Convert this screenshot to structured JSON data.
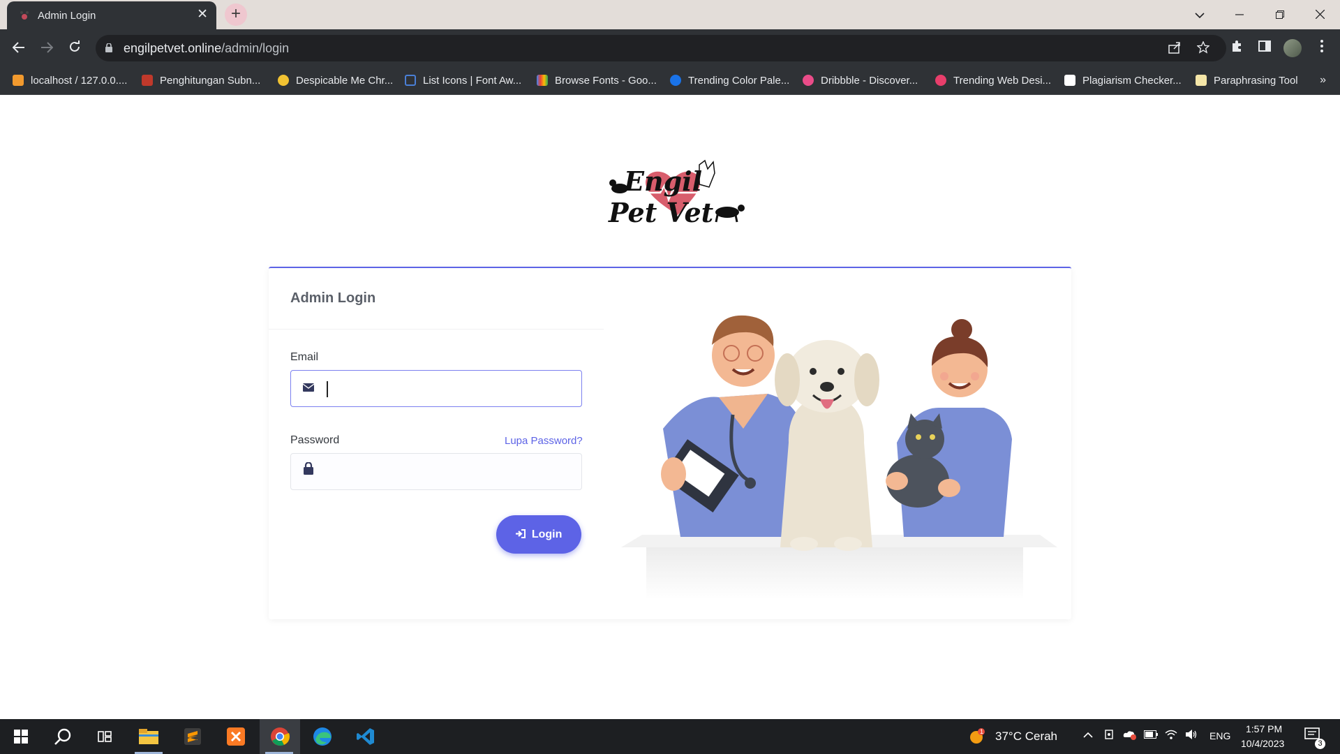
{
  "browser": {
    "tab_title": "Admin Login",
    "tab_close": "✕",
    "new_tab": "+",
    "url_host": "engilpetvet.online",
    "url_path": "/admin/login",
    "bookmarks": [
      {
        "label": "localhost / 127.0.0....",
        "color": "#f29a2e"
      },
      {
        "label": "Penghitungan Subn...",
        "color": "#c0392b"
      },
      {
        "label": "Despicable Me Chr...",
        "color": "#f1c232"
      },
      {
        "label": "List Icons | Font Aw...",
        "color": "#4a7fd6"
      },
      {
        "label": "Browse Fonts - Goo...",
        "color": "#34a853"
      },
      {
        "label": "Trending Color Pale...",
        "color": "#1a73e8"
      },
      {
        "label": "Dribbble - Discover...",
        "color": "#ea4c89"
      },
      {
        "label": "Trending Web Desi...",
        "color": "#e83e6b"
      },
      {
        "label": "Plagiarism Checker...",
        "color": "#ffffff"
      },
      {
        "label": "Paraphrasing Tool",
        "color": "#f5e6a8"
      }
    ],
    "bookmarks_more": "»"
  },
  "page": {
    "logo_alt": "Engil Pet Vet",
    "card_title": "Admin Login",
    "email_label": "Email",
    "email_value": "",
    "password_label": "Password",
    "password_value": "",
    "forgot_link": "Lupa Password?",
    "login_button": "Login"
  },
  "taskbar": {
    "weather": "37°C  Cerah",
    "weather_badge": "1",
    "language": "ENG",
    "time": "1:57 PM",
    "date": "10/4/2023",
    "notification_count": "3"
  },
  "colors": {
    "accent": "#5d63e6",
    "chrome_dark": "#2f3236",
    "tabstrip": "#e3ddd9",
    "scrub_blue": "#7b8fd6"
  }
}
